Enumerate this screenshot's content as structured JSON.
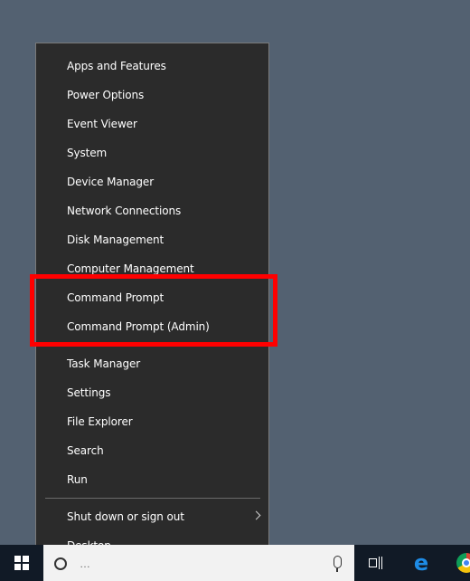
{
  "menu": {
    "items": [
      {
        "label": "Apps and Features"
      },
      {
        "label": "Power Options"
      },
      {
        "label": "Event Viewer"
      },
      {
        "label": "System"
      },
      {
        "label": "Device Manager"
      },
      {
        "label": "Network Connections"
      },
      {
        "label": "Disk Management"
      },
      {
        "label": "Computer Management"
      },
      {
        "label": "Command Prompt"
      },
      {
        "label": "Command Prompt (Admin)"
      },
      {
        "label": "Task Manager"
      },
      {
        "label": "Settings"
      },
      {
        "label": "File Explorer"
      },
      {
        "label": "Search"
      },
      {
        "label": "Run"
      },
      {
        "label": "Shut down or sign out"
      },
      {
        "label": "Desktop"
      }
    ]
  },
  "taskbar": {
    "search_placeholder": "…",
    "icons": [
      "windows-logo-icon",
      "search-icon",
      "microphone-icon",
      "task-view-icon",
      "edge-icon",
      "chrome-icon"
    ]
  },
  "colors": {
    "desktop": "#536171",
    "menu_bg": "#2b2b2b",
    "highlight": "#ff0000",
    "taskbar": "#111a26"
  }
}
